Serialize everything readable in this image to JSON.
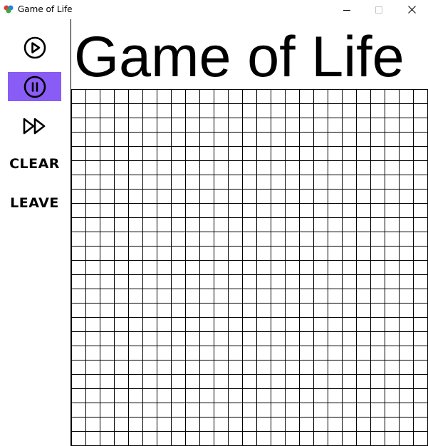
{
  "window": {
    "title": "Game of Life",
    "controls": [
      "minimize-icon",
      "maximize-icon",
      "close-icon"
    ]
  },
  "sidebar": {
    "play_icon": "play-circle-icon",
    "pause_icon": "pause-circle-icon",
    "fast_forward_icon": "fast-forward-icon",
    "clear_label": "CLEAR",
    "leave_label": "LEAVE",
    "active_color": "#8a5cf6"
  },
  "main": {
    "heading": "Game of Life"
  },
  "board": {
    "columns": 25,
    "rows": 25,
    "live_cells": []
  }
}
